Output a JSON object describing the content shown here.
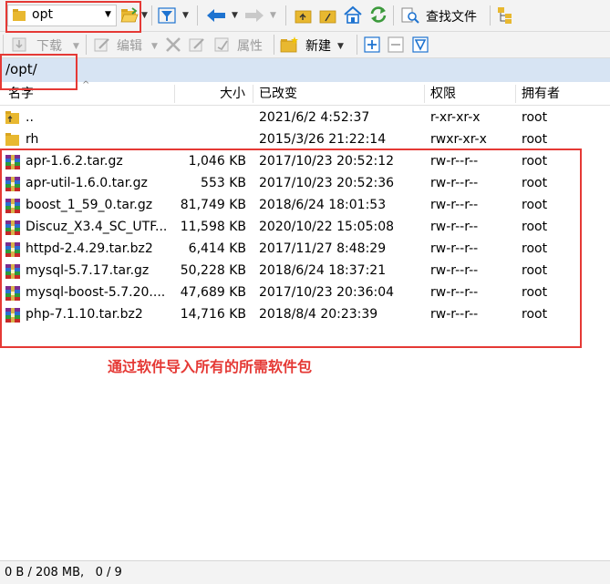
{
  "toolbar": {
    "folder_combo_value": "opt",
    "find_label": "查找文件"
  },
  "toolbar2": {
    "download_label": "下载",
    "edit_label": "编辑",
    "properties_label": "属性",
    "new_label": "新建"
  },
  "path": {
    "current": "/opt/"
  },
  "columns": {
    "name": "名字",
    "size": "大小",
    "modified": "已改变",
    "perms": "权限",
    "owner": "拥有者"
  },
  "rows": [
    {
      "name": "..",
      "size": "",
      "modified": "2021/6/2 4:52:37",
      "perms": "r-xr-xr-x",
      "owner": "root",
      "icon": "folder-up-icon"
    },
    {
      "name": "rh",
      "size": "",
      "modified": "2015/3/26 21:22:14",
      "perms": "rwxr-xr-x",
      "owner": "root",
      "icon": "folder-icon"
    },
    {
      "name": "apr-1.6.2.tar.gz",
      "size": "1,046 KB",
      "modified": "2017/10/23 20:52:12",
      "perms": "rw-r--r--",
      "owner": "root",
      "icon": "archive-icon"
    },
    {
      "name": "apr-util-1.6.0.tar.gz",
      "size": "553 KB",
      "modified": "2017/10/23 20:52:36",
      "perms": "rw-r--r--",
      "owner": "root",
      "icon": "archive-icon"
    },
    {
      "name": "boost_1_59_0.tar.gz",
      "size": "81,749 KB",
      "modified": "2018/6/24 18:01:53",
      "perms": "rw-r--r--",
      "owner": "root",
      "icon": "archive-icon"
    },
    {
      "name": "Discuz_X3.4_SC_UTF...",
      "size": "11,598 KB",
      "modified": "2020/10/22 15:05:08",
      "perms": "rw-r--r--",
      "owner": "root",
      "icon": "archive-icon"
    },
    {
      "name": "httpd-2.4.29.tar.bz2",
      "size": "6,414 KB",
      "modified": "2017/11/27 8:48:29",
      "perms": "rw-r--r--",
      "owner": "root",
      "icon": "archive-icon"
    },
    {
      "name": "mysql-5.7.17.tar.gz",
      "size": "50,228 KB",
      "modified": "2018/6/24 18:37:21",
      "perms": "rw-r--r--",
      "owner": "root",
      "icon": "archive-icon"
    },
    {
      "name": "mysql-boost-5.7.20....",
      "size": "47,689 KB",
      "modified": "2017/10/23 20:36:04",
      "perms": "rw-r--r--",
      "owner": "root",
      "icon": "archive-icon"
    },
    {
      "name": "php-7.1.10.tar.bz2",
      "size": "14,716 KB",
      "modified": "2018/8/4 20:23:39",
      "perms": "rw-r--r--",
      "owner": "root",
      "icon": "archive-icon"
    }
  ],
  "annotation": {
    "text": "通过软件导入所有的所需软件包",
    "color": "#e53935"
  },
  "status": {
    "text": "0 B / 208 MB,   0 / 9"
  },
  "colors": {
    "path_bar": "#d7e4f3",
    "accent_blue": "#1e73d0",
    "green": "#3c9a3c",
    "annotation_red": "#e53935"
  }
}
